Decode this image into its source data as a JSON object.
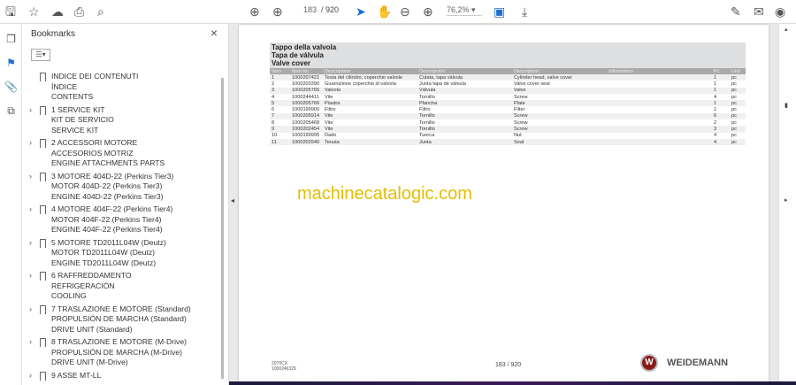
{
  "toolbar": {
    "current_page": "183",
    "total_pages": "/ 920",
    "zoom": "76,2%"
  },
  "bookmarks": {
    "title": "Bookmarks",
    "items": [
      {
        "expandable": false,
        "lines": [
          "INDICE DEI CONTENUTI",
          "ÍNDICE",
          "CONTENTS"
        ]
      },
      {
        "expandable": true,
        "lines": [
          "1 SERVICE KIT",
          "KIT DE SERVICIO",
          "SERVICE KIT"
        ]
      },
      {
        "expandable": true,
        "lines": [
          "2 ACCESSORI MOTORE",
          "ACCESORIOS MOTRIZ",
          "ENGINE ATTACHMENTS PARTS"
        ]
      },
      {
        "expandable": true,
        "lines": [
          "3 MOTORE 404D-22 (Perkins Tier3)",
          "MOTOR 404D-22 (Perkins Tier3)",
          "ENGINE 404D-22 (Perkins Tier3)"
        ]
      },
      {
        "expandable": true,
        "lines": [
          "4 MOTORE 404F-22 (Perkins Tier4)",
          "MOTOR 404F-22 (Perkins Tier4)",
          "ENGINE 404F-22 (Perkins Tier4)"
        ]
      },
      {
        "expandable": true,
        "lines": [
          "5 MOTORE TD2011L04W (Deutz)",
          "MOTOR TD2011L04W (Deutz)",
          "ENGINE TD2011L04W (Deutz)"
        ]
      },
      {
        "expandable": true,
        "lines": [
          "6 RAFFREDDAMENTO",
          "REFRIGERACIÓN",
          "COOLING"
        ]
      },
      {
        "expandable": true,
        "lines": [
          "7 TRASLAZIONE E MOTORE (Standard)",
          "PROPULSIÓN DE MARCHA (Standard)",
          "DRIVE UNIT (Standard)"
        ]
      },
      {
        "expandable": true,
        "lines": [
          "8 TRASLAZIONE E MOTORE (M-Drive)",
          "PROPULSIÓN DE MARCHA (M-Drive)",
          "DRIVE UNIT (M-Drive)"
        ]
      },
      {
        "expandable": true,
        "lines": [
          "9 ASSE MT-LL"
        ]
      }
    ]
  },
  "document": {
    "title_lines": [
      "Tappo della valvola",
      "Tapa de válvula",
      "Valve cover"
    ],
    "columns": [
      "Item",
      "Item no.",
      "Descrizione",
      "Descripción",
      "Description",
      "Information",
      "Pc.",
      "Unit"
    ],
    "rows": [
      [
        "1",
        "1000207421",
        "Testa del cilindro, coperchio valvole",
        "Culata, tapa válvula",
        "Cylinder head, valve cover",
        "",
        "1",
        "pc"
      ],
      [
        "2",
        "1000203390",
        "Guarnizione coperchio di valvola",
        "Junta tapa de válvula",
        "Valve cover seal",
        "",
        "1",
        "pc"
      ],
      [
        "3",
        "1000205765",
        "Valvola",
        "Válvula",
        "Valve",
        "",
        "1",
        "pc"
      ],
      [
        "4",
        "1000244411",
        "Vite",
        "Tornillo",
        "Screw",
        "",
        "4",
        "pc"
      ],
      [
        "5",
        "1000205766",
        "Piastra",
        "Plancha",
        "Plate",
        "",
        "1",
        "pc"
      ],
      [
        "6",
        "1000199900",
        "Filtro",
        "Filtro",
        "Filter",
        "",
        "1",
        "pc"
      ],
      [
        "7",
        "1000205914",
        "Vite",
        "Tornillo",
        "Screw",
        "",
        "6",
        "pc"
      ],
      [
        "8",
        "1000205468",
        "Vite",
        "Tornillo",
        "Screw",
        "",
        "2",
        "pc"
      ],
      [
        "9",
        "1000202454",
        "Vite",
        "Tornillo",
        "Screw",
        "",
        "3",
        "pc"
      ],
      [
        "10",
        "1000199995",
        "Dado",
        "Tuerca",
        "Nut",
        "",
        "4",
        "pc"
      ],
      [
        "11",
        "1000202540",
        "Tenuta",
        "Junta",
        "Seal",
        "",
        "4",
        "pc"
      ]
    ],
    "watermark": "machinecatalogic.com",
    "footer_model": "2070CX",
    "footer_code": "1000246329",
    "footer_page": "183 / 920",
    "brand": "WEIDEMANN"
  }
}
